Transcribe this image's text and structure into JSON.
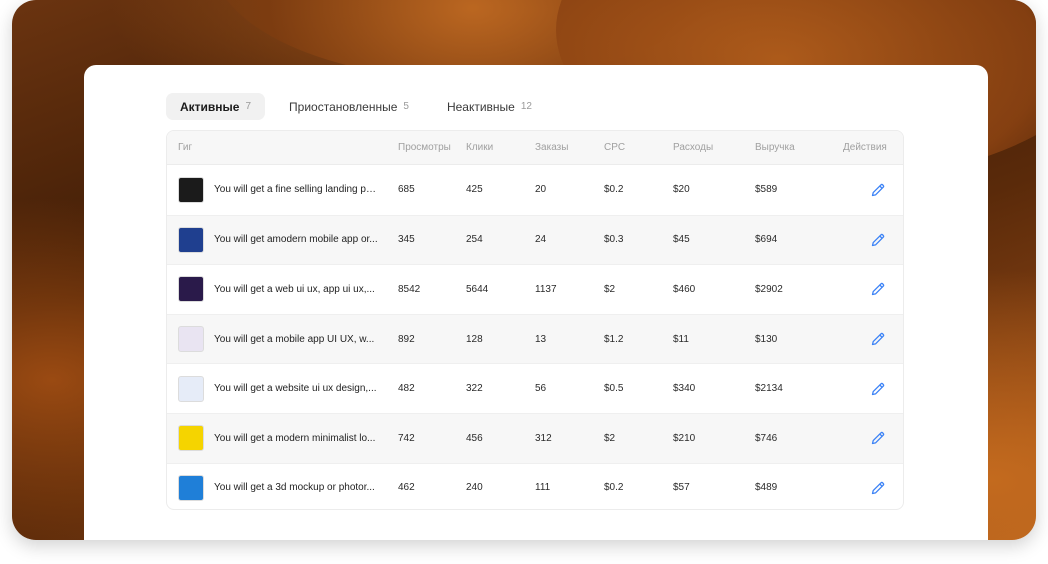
{
  "tabs": [
    {
      "label": "Активные",
      "count": "7"
    },
    {
      "label": "Приостановленные",
      "count": "5"
    },
    {
      "label": "Неактивные",
      "count": "12"
    }
  ],
  "table": {
    "headers": {
      "gig": "Гиг",
      "views": "Просмотры",
      "clicks": "Клики",
      "orders": "Заказы",
      "cpc": "CPC",
      "spend": "Расходы",
      "revenue": "Выручка",
      "actions": "Действия"
    },
    "rows": [
      {
        "title": "You will get a fine selling landing pa...",
        "views": "685",
        "clicks": "425",
        "orders": "20",
        "cpc": "$0.2",
        "spend": "$20",
        "revenue": "$589",
        "thumb_color": "#1b1b1b"
      },
      {
        "title": "You will get amodern mobile app or...",
        "views": "345",
        "clicks": "254",
        "orders": "24",
        "cpc": "$0.3",
        "spend": "$45",
        "revenue": "$694",
        "thumb_color": "#1f3f8f"
      },
      {
        "title": "You will get a web ui ux, app ui ux,...",
        "views": "8542",
        "clicks": "5644",
        "orders": "1137",
        "cpc": "$2",
        "spend": "$460",
        "revenue": "$2902",
        "thumb_color": "#2a1a4a"
      },
      {
        "title": "You will get a  mobile app UI UX, w...",
        "views": "892",
        "clicks": "128",
        "orders": "13",
        "cpc": "$1.2",
        "spend": "$11",
        "revenue": "$130",
        "thumb_color": "#e9e4f2"
      },
      {
        "title": "You will get a website ui ux design,...",
        "views": "482",
        "clicks": "322",
        "orders": "56",
        "cpc": "$0.5",
        "spend": "$340",
        "revenue": "$2134",
        "thumb_color": "#e6ecf8"
      },
      {
        "title": "You will get a modern minimalist lo...",
        "views": "742",
        "clicks": "456",
        "orders": "312",
        "cpc": "$2",
        "spend": "$210",
        "revenue": "$746",
        "thumb_color": "#f5d400"
      },
      {
        "title": "You will get a 3d mockup or photor...",
        "views": "462",
        "clicks": "240",
        "orders": "111",
        "cpc": "$0.2",
        "spend": "$57",
        "revenue": "$489",
        "thumb_color": "#1f7fd8"
      }
    ]
  },
  "colors": {
    "accent": "#3b82f6",
    "active_tab_bg": "#f1f1f1",
    "row_alt_bg": "#f7f7f7"
  },
  "icons": {
    "edit": "pencil-icon"
  }
}
